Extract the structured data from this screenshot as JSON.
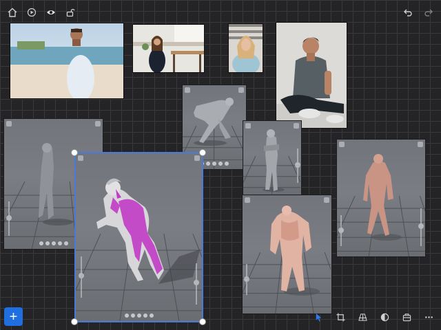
{
  "toolbar": {
    "left_icons": [
      "home-icon",
      "play-icon",
      "eye-icon",
      "unlock-icon"
    ],
    "right_icons": [
      "undo-icon",
      "redo-icon"
    ]
  },
  "add_button": {
    "label": "+"
  },
  "bottom_tools": [
    "select-arrow-icon",
    "crop-icon",
    "perspective-icon",
    "contrast-icon",
    "package-icon",
    "more-icon"
  ],
  "colors": {
    "accent": "#1f6fe0",
    "selection": "#4a7ad9",
    "background": "#242426",
    "grid": "#3a3a3d",
    "highlight_muscle": "#c23cc4",
    "skin_figure": "#d9a99a"
  }
}
